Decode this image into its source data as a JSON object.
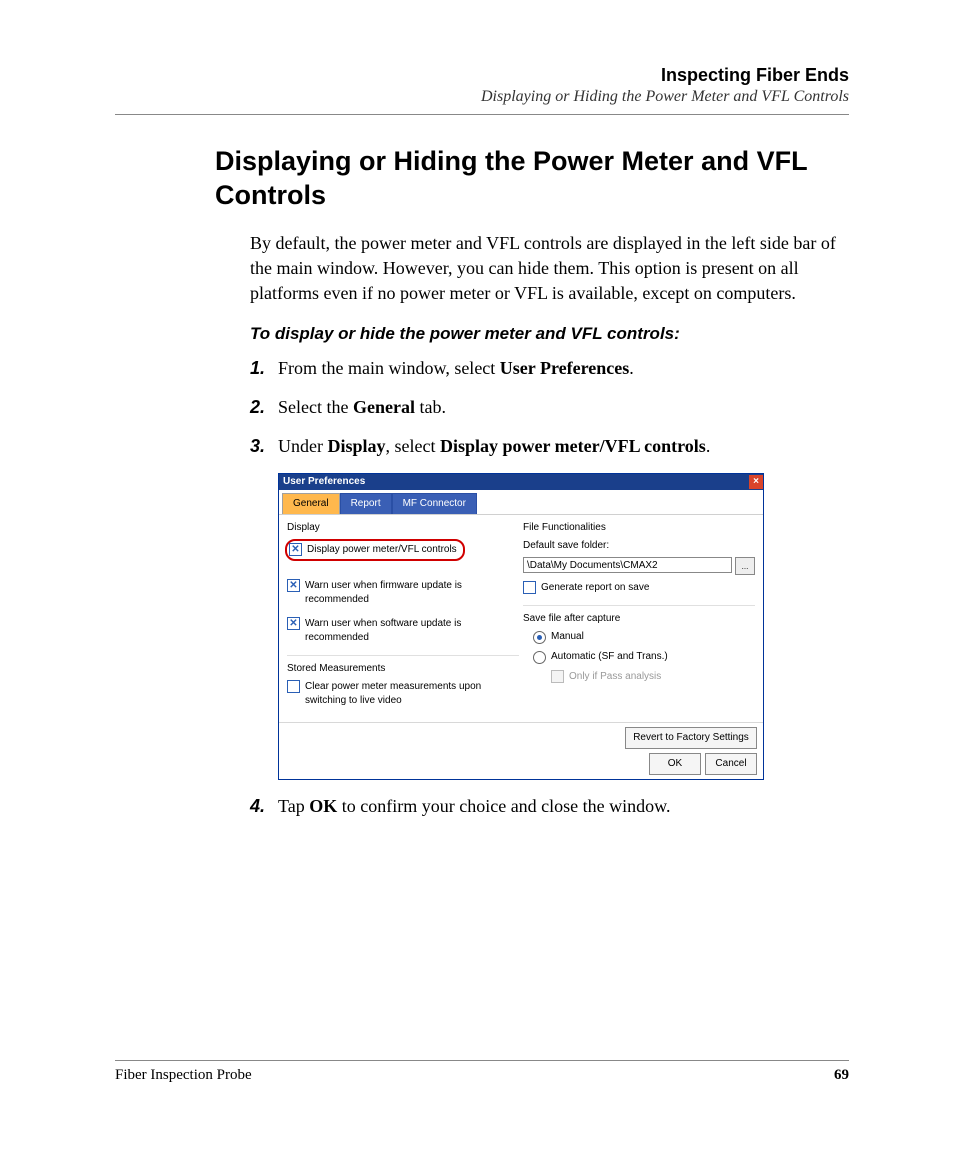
{
  "header": {
    "chapter": "Inspecting Fiber Ends",
    "subtitle": "Displaying or Hiding the Power Meter and VFL Controls"
  },
  "heading": "Displaying or Hiding the Power Meter and VFL Controls",
  "intro": "By default, the power meter and VFL controls are displayed in the left side bar of the main window. However, you can hide them. This option is present on all platforms even if no power meter or VFL is available, except on computers.",
  "proc_heading": "To display or hide the power meter and VFL controls:",
  "steps": {
    "s1_num": "1.",
    "s1_pre": "From the main window, select ",
    "s1_bold": "User Preferences",
    "s1_post": ".",
    "s2_num": "2.",
    "s2_pre": "Select the ",
    "s2_bold": "General",
    "s2_post": " tab.",
    "s3_num": "3.",
    "s3_pre": "Under ",
    "s3_bold1": "Display",
    "s3_mid": ", select ",
    "s3_bold2": "Display power meter/VFL controls",
    "s3_post": ".",
    "s4_num": "4.",
    "s4_pre": "Tap ",
    "s4_bold": "OK",
    "s4_post": " to confirm your choice and close the window."
  },
  "dialog": {
    "title": "User Preferences",
    "tabs": {
      "general": "General",
      "report": "Report",
      "mf": "MF Connector"
    },
    "display_label": "Display",
    "chk_display_pm": "Display power meter/VFL controls",
    "chk_warn_fw": "Warn user when firmware update is recommended",
    "chk_warn_sw": "Warn user when software update is recommended",
    "stored_label": "Stored Measurements",
    "chk_clear": "Clear power meter measurements upon switching to live video",
    "file_label": "File Functionalities",
    "default_folder_label": "Default save folder:",
    "folder_path": "\\Data\\My Documents\\CMAX2",
    "browse": "...",
    "chk_gen_report": "Generate report on save",
    "save_after_label": "Save file after capture",
    "radio_manual": "Manual",
    "radio_auto": "Automatic (SF and Trans.)",
    "chk_only_pass": "Only if Pass analysis",
    "btn_revert": "Revert to Factory Settings",
    "btn_ok": "OK",
    "btn_cancel": "Cancel"
  },
  "footer": {
    "product": "Fiber Inspection Probe",
    "page": "69"
  }
}
